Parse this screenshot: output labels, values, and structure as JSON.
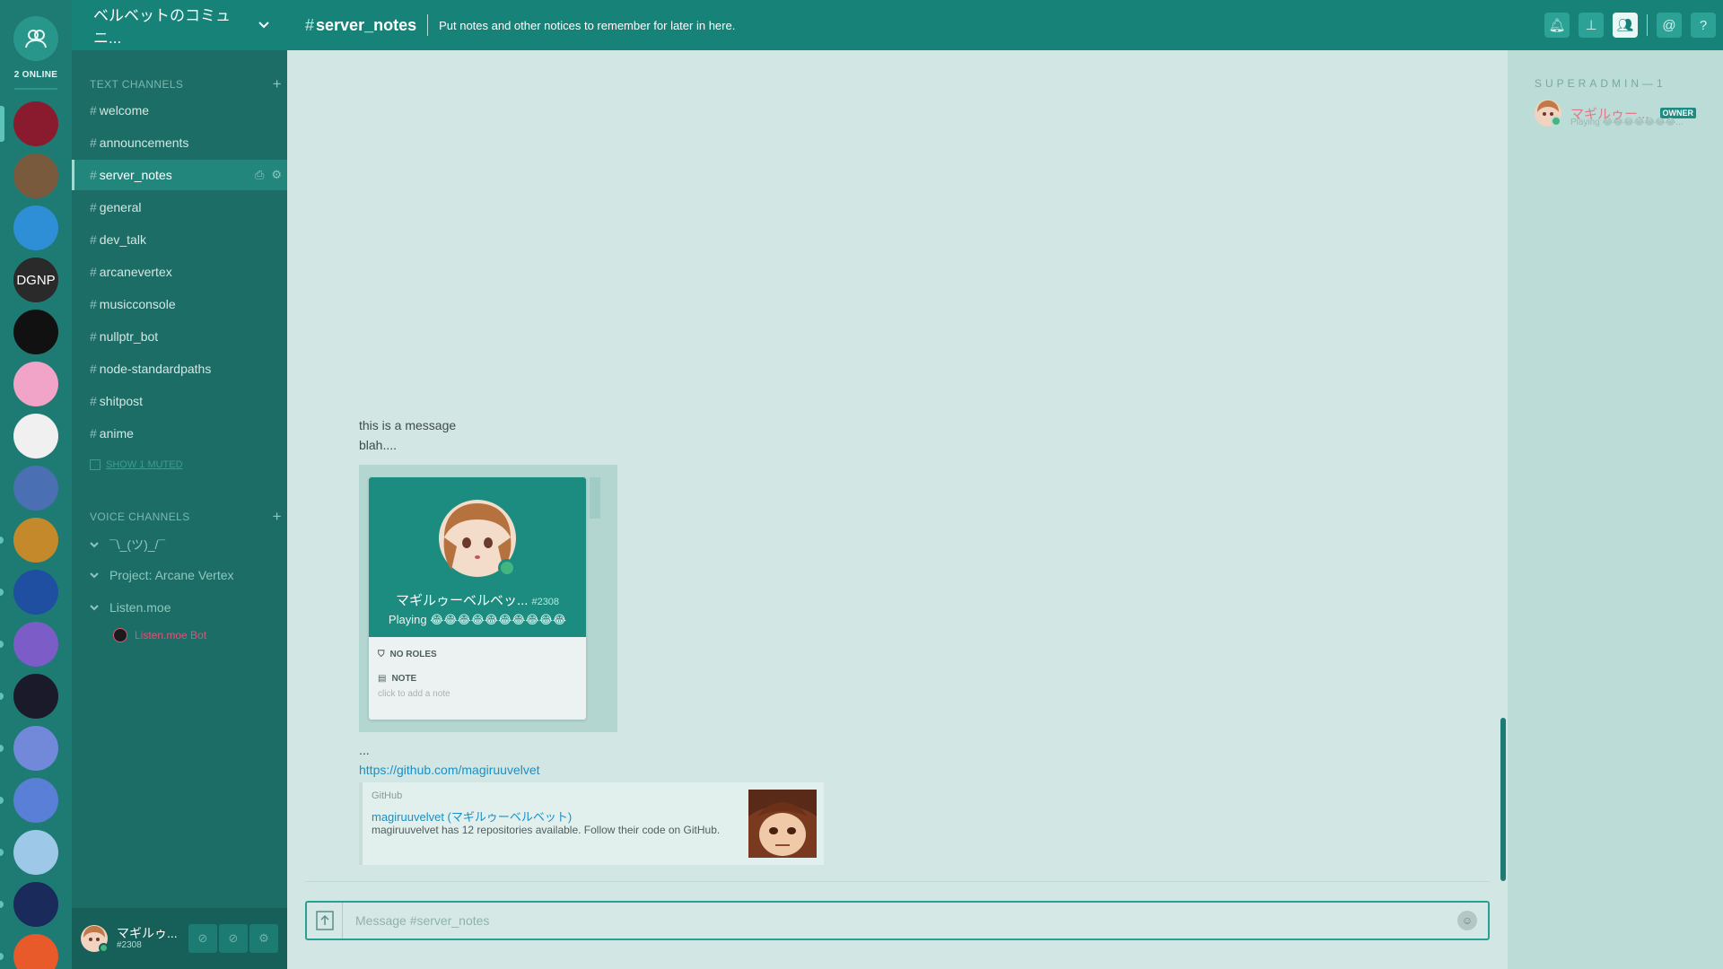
{
  "guild_bar": {
    "online_count": "2 ONLINE",
    "guilds": [
      {
        "name": "guild-1",
        "text": "",
        "color": "#8a1b2e"
      },
      {
        "name": "guild-2",
        "text": "",
        "color": "#7a5a3c"
      },
      {
        "name": "guild-3",
        "text": "",
        "color": "#2f8fd6"
      },
      {
        "name": "guild-dgnp",
        "text": "DGNP",
        "color": "#2a2a2a"
      },
      {
        "name": "guild-5",
        "text": "",
        "color": "#111111"
      },
      {
        "name": "guild-6",
        "text": "",
        "color": "#f2a3c8"
      },
      {
        "name": "guild-7",
        "text": "",
        "color": "#f0f0f0"
      },
      {
        "name": "guild-8",
        "text": "",
        "color": "#4b6fb3"
      },
      {
        "name": "guild-9",
        "text": "",
        "color": "#c4892a"
      },
      {
        "name": "guild-10",
        "text": "",
        "color": "#1f4fa0"
      },
      {
        "name": "guild-11",
        "text": "",
        "color": "#7c5cc6"
      },
      {
        "name": "guild-12",
        "text": "",
        "color": "#1a1a2a"
      },
      {
        "name": "guild-13",
        "text": "",
        "color": "#7289da"
      },
      {
        "name": "guild-14",
        "text": "",
        "color": "#5a7fd6"
      },
      {
        "name": "guild-15",
        "text": "",
        "color": "#9ec8e8"
      },
      {
        "name": "guild-16",
        "text": "",
        "color": "#1a2a5a"
      },
      {
        "name": "guild-17",
        "text": "",
        "color": "#e85a2a"
      }
    ]
  },
  "server": {
    "name": "ベルベットのコミュニ...",
    "text_channels_label": "TEXT CHANNELS",
    "voice_channels_label": "VOICE CHANNELS",
    "show_muted": "SHOW 1 MUTED",
    "text_channels": [
      "welcome",
      "announcements",
      "server_notes",
      "general",
      "dev_talk",
      "arcanevertex",
      "musicconsole",
      "nullptr_bot",
      "node-standardpaths",
      "shitpost",
      "anime"
    ],
    "active_channel": "server_notes",
    "voice_channels": [
      "¯\\_(ツ)_/¯",
      "Project: Arcane Vertex",
      "Listen.moe"
    ],
    "voice_user": "Listen.moe Bot"
  },
  "user_panel": {
    "name": "マギルゥ...",
    "discriminator": "#2308"
  },
  "header": {
    "hash": "#",
    "channel": "server_notes",
    "topic": "Put notes and other notices to remember for later in here."
  },
  "messages": {
    "line1": "this is a message",
    "line2": "blah....",
    "ellipsis": "...",
    "link": "https://github.com/magiruuvelvet"
  },
  "popout": {
    "name": "マギルゥーベルベッ...",
    "discriminator": "#2308",
    "playing": "Playing 😂😂😂😂😂😂😂😂😂😂",
    "roles_label": "NO ROLES",
    "note_label": "NOTE",
    "note_hint": "click to add a note"
  },
  "embed": {
    "provider": "GitHub",
    "title": "magiruuvelvet (マギルゥーベルベット)",
    "description": "magiruuvelvet has 12 repositories available. Follow their code on GitHub."
  },
  "composer": {
    "placeholder": "Message #server_notes"
  },
  "members": {
    "header": "SUPERADMIN—1",
    "name": "マギルゥー...",
    "badge": "OWNER",
    "playing": "Playing 😂😂😂😂😂😂😂..."
  }
}
